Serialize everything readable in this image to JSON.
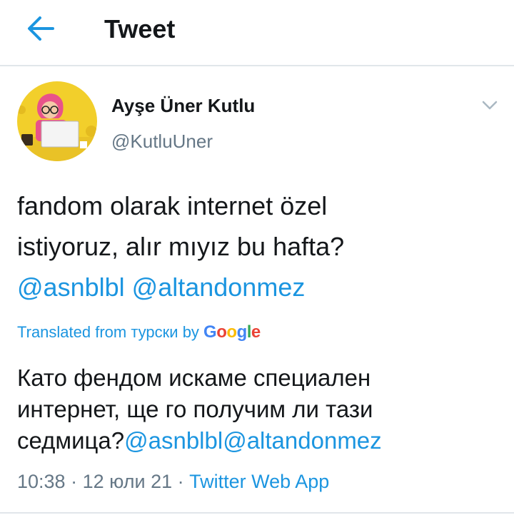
{
  "colors": {
    "accent": "#1b95e0",
    "text": "#14171a",
    "muted": "#657786",
    "divider": "#e1e6ea"
  },
  "header": {
    "title": "Tweet",
    "back_icon": "arrow-left-icon"
  },
  "author": {
    "name": "Ayşe Üner Kutlu",
    "handle": "@KutluUner"
  },
  "tweet": {
    "line1": "fandom olarak internet özel",
    "line2": "istiyoruz, alır mıyız bu hafta?",
    "mention1": "@asnblbl",
    "mention2": "@altandonmez"
  },
  "translation": {
    "label_prefix": "Translated from турски by ",
    "provider": "Google",
    "line1": "Като фендом искаме специален",
    "line2": "интернет, ще го получим ли тази",
    "line3_text": "седмица?",
    "mention1": "@asnblbl",
    "mention2": "@altandonmez"
  },
  "meta": {
    "time": "10:38",
    "sep": " · ",
    "date": "12 юли 21",
    "source": "Twitter Web App"
  }
}
